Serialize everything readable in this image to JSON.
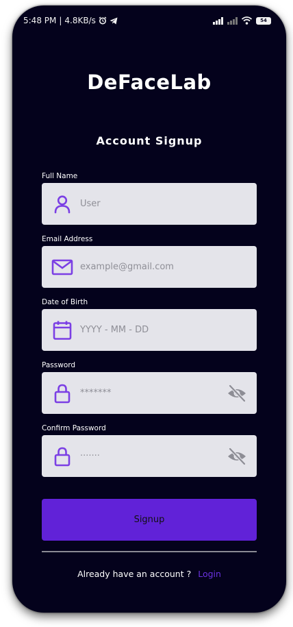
{
  "status_bar": {
    "time": "5:48 PM",
    "separator": "|",
    "speed": "4.8KB/s",
    "alarm_icon": "alarm-clock-icon",
    "telegram_icon": "telegram-icon",
    "battery": "54"
  },
  "app": {
    "title": "DeFaceLab"
  },
  "form": {
    "title": "Account Signup",
    "fields": [
      {
        "label": "Full Name",
        "value": "User",
        "icon": "user-icon"
      },
      {
        "label": "Email Address",
        "value": "example@gmail.com",
        "icon": "mail-icon"
      },
      {
        "label": "Date of Birth",
        "value": "YYYY - MM - DD",
        "icon": "calendar-icon"
      },
      {
        "label": "Password",
        "value": "*******",
        "icon": "lock-icon",
        "toggle_icon": "eye-off-icon"
      },
      {
        "label": "Confirm Password",
        "value": "·······",
        "icon": "lock-icon",
        "toggle_icon": "eye-off-icon"
      }
    ],
    "submit_label": "Signup"
  },
  "footer": {
    "prompt": "Already have an account ?",
    "link": "Login"
  },
  "colors": {
    "background": "#04021c",
    "field_bg": "#e4e4ea",
    "accent": "#6122d8",
    "icon_purple": "#7b3fe4",
    "placeholder": "#8f8f97"
  }
}
